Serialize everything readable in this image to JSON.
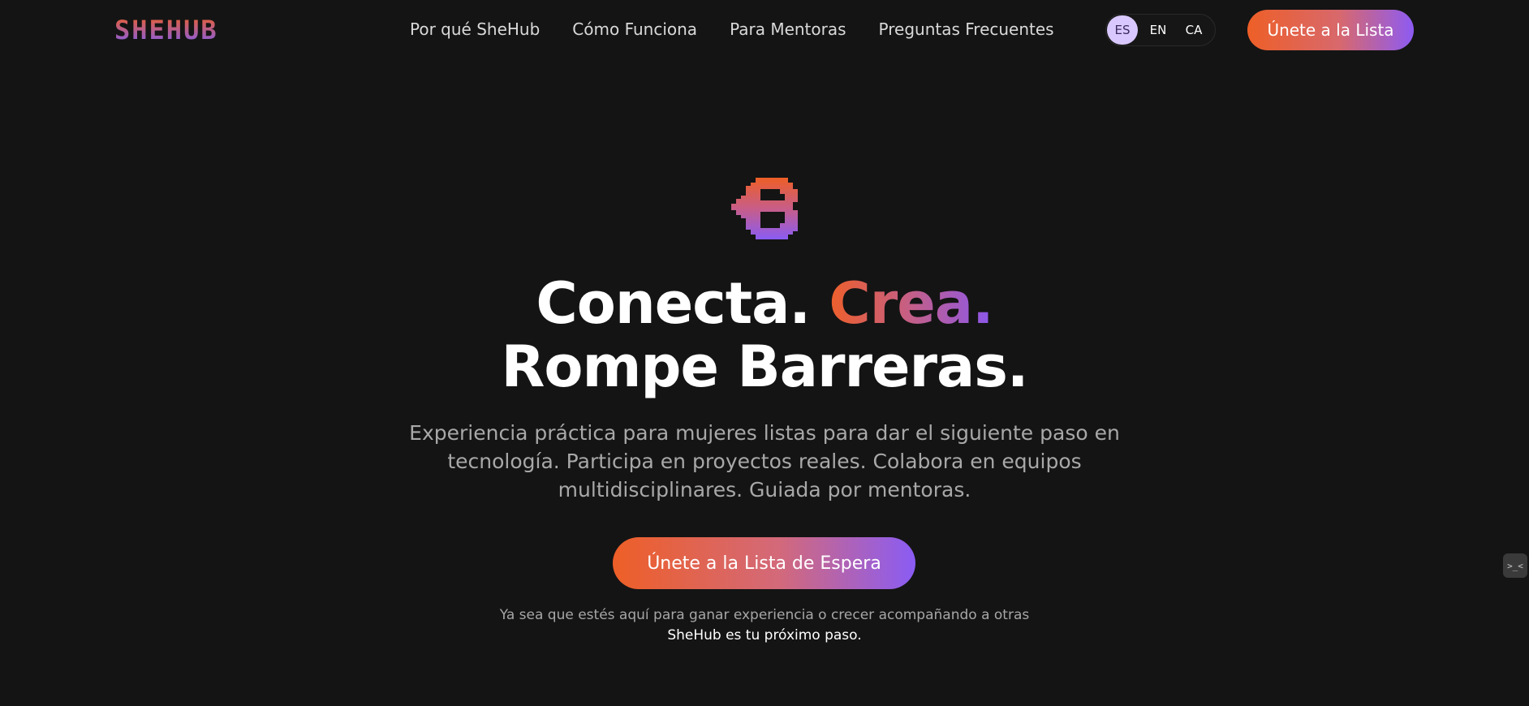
{
  "brand": {
    "logo_text": "SHEHUB"
  },
  "nav": {
    "links": [
      "Por qué SheHub",
      "Cómo Funciona",
      "Para Mentoras",
      "Preguntas Frecuentes"
    ],
    "languages": [
      {
        "code": "ES",
        "active": true
      },
      {
        "code": "EN",
        "active": false
      },
      {
        "code": "CA",
        "active": false
      }
    ],
    "cta_label": "Únete a la Lista"
  },
  "hero": {
    "headline_plain": "Conecta.",
    "headline_gradient": "Crea.",
    "headline_line2": "Rompe Barreras.",
    "subtitle": "Experiencia práctica para mujeres listas para dar el siguiente paso en tecnología. Participa en proyectos reales. Colabora en equipos multidisciplinares. Guiada por mentoras.",
    "cta_label": "Únete a la Lista de Espera",
    "note_line1": "Ya sea que estés aquí para ganar experiencia o crecer acompañando a otras",
    "note_line2": "SheHub es tu próximo paso."
  },
  "widgets": {
    "side_widget_icon": "code-bracket-icon",
    "side_widget_glyph": ">_<"
  },
  "colors": {
    "background": "#141414",
    "gradient_start": "#ee5f27",
    "gradient_end": "#8a5cf4",
    "active_language_bg": "#d9c8ff"
  }
}
